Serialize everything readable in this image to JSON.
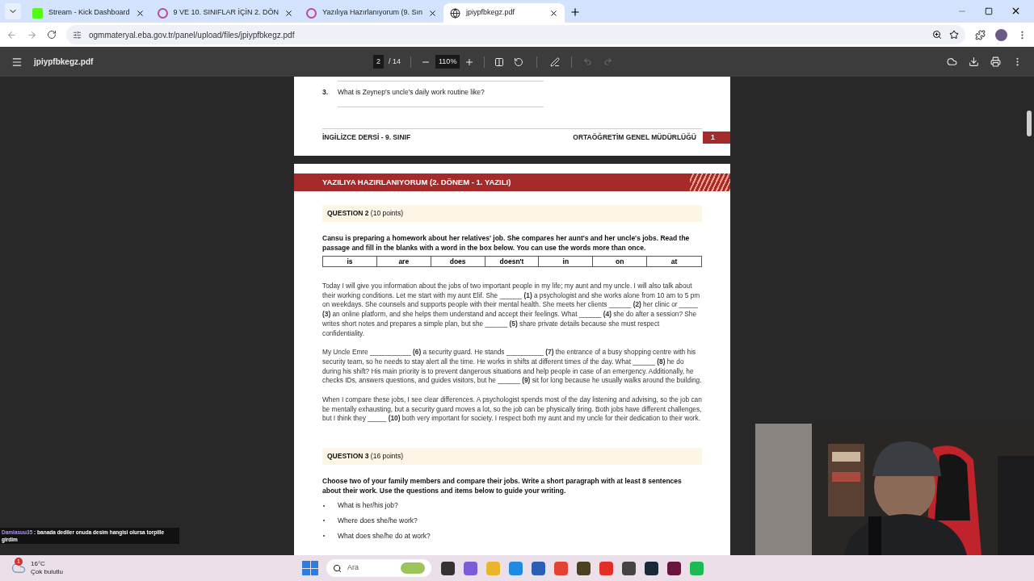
{
  "tabs": [
    {
      "title": "Stream - Kick Dashboard",
      "selected": false
    },
    {
      "title": "9 VE 10. SINIFLAR İÇİN 2. DÖN",
      "selected": false
    },
    {
      "title": "Yazılıya Hazırlanıyorum (9. Sın",
      "selected": false
    },
    {
      "title": "jpiypfbkegz.pdf",
      "selected": true
    }
  ],
  "address": "ogmmateryal.eba.gov.tr/panel/upload/files/jpiypfbkegz.pdf",
  "viewer": {
    "filename": "jpiypfbkegz.pdf",
    "page": "2",
    "page_total": "/ 14",
    "zoom": "110%"
  },
  "page_end": {
    "question_number": "3.",
    "question": "What is Zeynep's uncle's daily work routine like?",
    "footer_left": "İNGİLİZCE DERSİ - 9. SINIF",
    "footer_right": "ORTAÖĞRETİM GENEL MÜDÜRLÜĞÜ",
    "page_number": "1"
  },
  "page": {
    "banner": "YAZILIYA HAZIRLANIYORUM (2. DÖNEM - 1. YAZILI)",
    "questions": [
      {
        "kind": "fill",
        "heading": "QUESTION 2",
        "points": "(10 points)",
        "instructions": "Cansu is preparing a homework about her relatives' job. She compares her aunt's and her uncle's jobs. Read the passage and fill in the blanks with a word in the box below. You can use the words more than once.",
        "word_box": [
          "is",
          "are",
          "does",
          "doesn't",
          "in",
          "on",
          "at"
        ],
        "paragraphs": [
          "Today I will give you information about the jobs of two important people in my life; my aunt and my  uncle. I will also talk about their working conditions. Let me start with my aunt Elif. She ______ **(1)** a psychologist and she works alone from 10 am to 5 pm on weekdays. She counsels and supports people with their mental health. She meets her clients ______ **(2)** her clinic or _____ **(3)** an online platform, and she helps them understand and accept their feelings. What ______ **(4)** she do after a session? She writes short notes and prepares a simple plan, but she ______ **(5)** share private details because she must respect confidentiality.",
          "My Uncle Emre ___________ **(6)** a security guard. He stands __________ **(7)** the entrance of a busy shopping centre with his security team, so he needs to stay alert all the time. He works in shifts at different times of the day. What ______ **(8)** he do during his shift? His main priority is to prevent dangerous situations and help people in case of an emergency. Additionally, he checks IDs, answers questions, and guides visitors, but he ______ **(9)** sit for long because he usually walks around the building.",
          "When I compare these jobs, I see clear differences. A psychologist spends most of the day listening and advising, so the job can be mentally exhausting, but a security guard moves a lot, so the job can be physically tiring. Both jobs have different challenges, but I think they _____ **(10)** both very important for society. I respect both my aunt and my uncle for their dedication to their work."
        ]
      },
      {
        "kind": "writing",
        "heading": "QUESTION 3",
        "points": "(16 points)",
        "instructions": "Choose two of your family members and compare their jobs. Write a short paragraph with at least 8 sentences about their work. Use the questions and items below to guide your writing.",
        "bullets": [
          "What is her/his job?",
          "Where does she/he work?",
          "What does she/he do at work?"
        ]
      }
    ]
  },
  "chat": {
    "user": "Damlasuu35",
    "message": ": banada dediler onuda desim hangisi olursa torpille girdim"
  },
  "taskbar": {
    "weather_badge": "1",
    "temperature": "16°C",
    "condition": "Çok bulutlu",
    "search": "Ara"
  }
}
